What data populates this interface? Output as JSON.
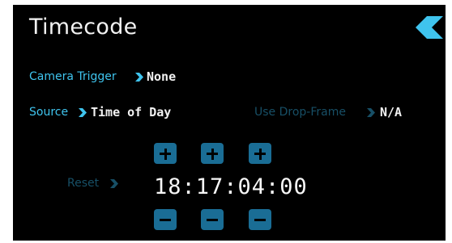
{
  "header": {
    "title": "Timecode"
  },
  "camera_trigger": {
    "label": "Camera Trigger",
    "value": "None"
  },
  "source": {
    "label": "Source",
    "value": "Time of Day"
  },
  "drop_frame": {
    "label": "Use Drop-Frame",
    "value": "N/A"
  },
  "reset": {
    "label": "Reset"
  },
  "timecode": {
    "value": "18:17:04:00"
  },
  "colors": {
    "accent": "#3fc4ee",
    "accent_dim": "#174f66",
    "stepper": "#1a6d95",
    "background": "#000000",
    "text": "#f2f2f2"
  },
  "icons": {
    "back": "chevron-left-icon",
    "label_arrow": "chevron-right-icon",
    "increment": "plus-icon",
    "decrement": "minus-icon"
  }
}
